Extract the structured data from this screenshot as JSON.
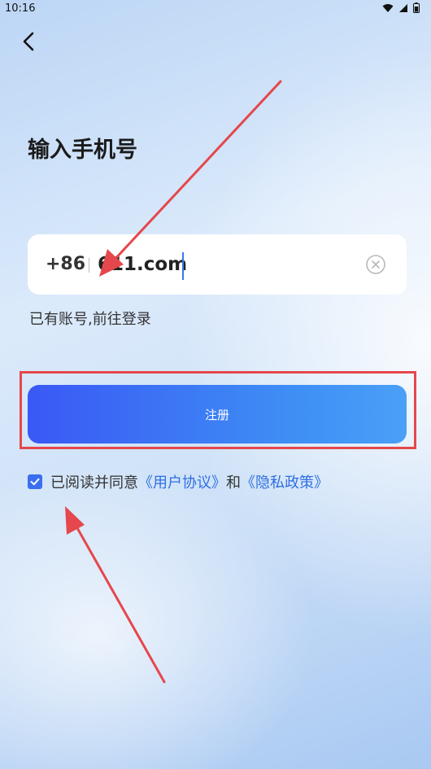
{
  "status_bar": {
    "time": "10:16"
  },
  "header": {
    "title": "输入手机号"
  },
  "phone": {
    "country_code": "+86",
    "value": "611.com"
  },
  "login_link": "已有账号,前往登录",
  "register_button": "注册",
  "agreement": {
    "checked": true,
    "prefix": "已阅读并同意",
    "user_agreement": "《用户协议》",
    "and": "和",
    "privacy_policy": "《隐私政策》"
  },
  "colors": {
    "accent": "#3b6ef0",
    "link": "#2f6fe0",
    "annotation": "#e5474c"
  }
}
